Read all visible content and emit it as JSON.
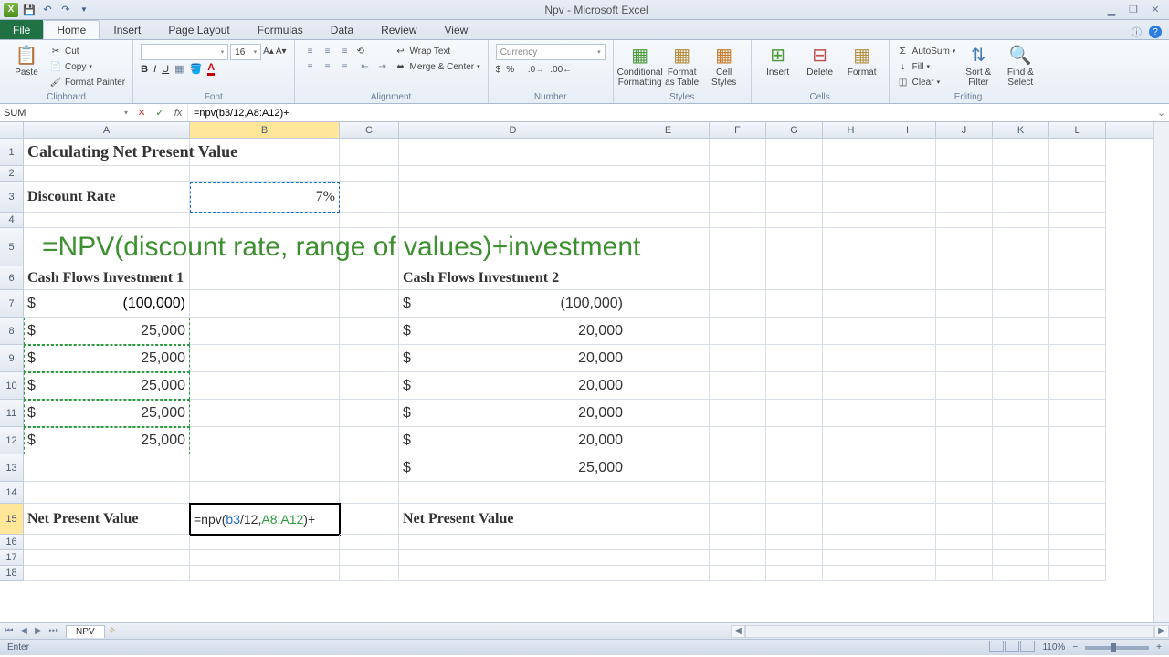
{
  "titlebar": {
    "title": "Npv - Microsoft Excel"
  },
  "tabs": {
    "file": "File",
    "home": "Home",
    "insert": "Insert",
    "page_layout": "Page Layout",
    "formulas": "Formulas",
    "data": "Data",
    "review": "Review",
    "view": "View"
  },
  "ribbon": {
    "clipboard": {
      "paste": "Paste",
      "cut": "Cut",
      "copy": "Copy",
      "format_painter": "Format Painter",
      "label": "Clipboard"
    },
    "font": {
      "size": "16",
      "label": "Font"
    },
    "alignment": {
      "wrap": "Wrap Text",
      "merge": "Merge & Center",
      "label": "Alignment"
    },
    "number": {
      "format": "Currency",
      "label": "Number"
    },
    "styles": {
      "cond": "Conditional\nFormatting",
      "table": "Format\nas Table",
      "cell": "Cell\nStyles",
      "label": "Styles"
    },
    "cells": {
      "insert": "Insert",
      "delete": "Delete",
      "format": "Format",
      "label": "Cells"
    },
    "editing": {
      "autosum": "AutoSum",
      "fill": "Fill",
      "clear": "Clear",
      "sort": "Sort &\nFilter",
      "find": "Find &\nSelect",
      "label": "Editing"
    }
  },
  "formula_bar": {
    "name": "SUM",
    "formula": "=npv(b3/12,A8:A12)+"
  },
  "columns": [
    "A",
    "B",
    "C",
    "D",
    "E",
    "F",
    "G",
    "H",
    "I",
    "J",
    "K",
    "L"
  ],
  "sheet": {
    "title": "Calculating Net Present Value",
    "discount_label": "Discount Rate",
    "discount_value": "7%",
    "big_formula": "=NPV(discount rate, range of values)+investment",
    "cf1_header": "Cash Flows Investment 1",
    "cf2_header": "Cash Flows Investment 2",
    "cf1": [
      "(100,000)",
      "25,000",
      "25,000",
      "25,000",
      "25,000",
      "25,000"
    ],
    "cf2": [
      "(100,000)",
      "20,000",
      "20,000",
      "20,000",
      "20,000",
      "20,000",
      "25,000"
    ],
    "npv_label": "Net Present Value",
    "edit_formula_pre": "=npv(",
    "edit_formula_p1": "b3",
    "edit_formula_mid": "/12,",
    "edit_formula_p2": "A8:A12",
    "edit_formula_post": ")+"
  },
  "sheettab": "NPV",
  "status": {
    "mode": "Enter",
    "zoom": "110%"
  }
}
